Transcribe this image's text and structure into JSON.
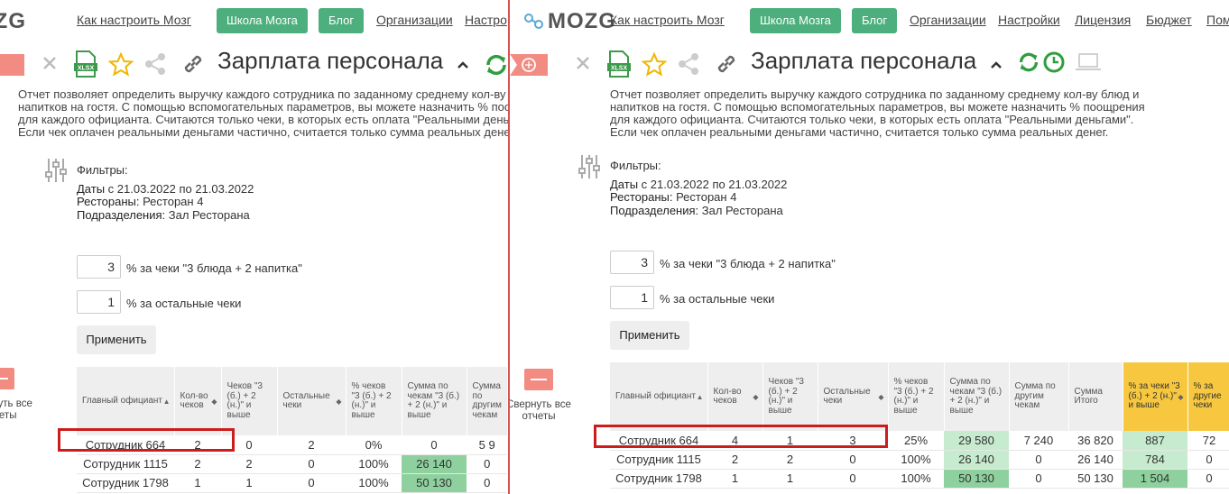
{
  "nav": {
    "logo": "MOZG",
    "links": [
      "Как настроить Мозг",
      "Организации",
      "Настройки",
      "Лицензия",
      "Бюджет",
      "Пом"
    ],
    "buttons": [
      "Школа Мозга",
      "Блог"
    ],
    "left_truncated_link": "Настро"
  },
  "report": {
    "title": "Зарплата персонала",
    "xlsx_label": "XLSX",
    "description": "Отчет позволяет определить выручку каждого сотрудника по заданному среднему кол-ву блюд и напитков на гостя. С помощью вспомогательных параметров, вы можете назначить % поощрения для каждого официанта. Считаются только чеки, в которых есть оплата \"Реальными деньгами\". Если чек оплачен реальными деньгами частично, считается только сумма реальных денег.",
    "filters_header": "Фильтры:",
    "filters": [
      {
        "label": "Даты",
        "value": " с 21.03.2022 по 21.03.2022"
      },
      {
        "label": "Рестораны:",
        "value": " Ресторан 4"
      },
      {
        "label": "Подразделения:",
        "value": " Зал Ресторана"
      }
    ],
    "param1": {
      "value": "3",
      "label": "% за чеки \"3 блюда + 2 напитка\""
    },
    "param2": {
      "value": "1",
      "label": "% за остальные чеки"
    },
    "apply_label": "Применить",
    "collapse_label": "Свернуть все отчеты"
  },
  "table": {
    "headers": [
      "Главный официант",
      "Кол-во чеков",
      "Чеков \"3 (б.) + 2 (н.)\" и выше",
      "Остальные чеки",
      "% чеков \"3 (б.) + 2 (н.)\" и выше",
      "Сумма по чекам \"3 (б.) + 2 (н.)\" и выше",
      "Сумма по другим чекам",
      "Сумма Итого",
      "% за чеки \"3 (б.) + 2 (н.)\" и выше",
      "% за другие чеки"
    ],
    "left_rows": [
      [
        "Сотрудник 664",
        "2",
        "0",
        "2",
        "0%",
        "0",
        "5 9"
      ],
      [
        "Сотрудник 1115",
        "2",
        "2",
        "0",
        "100%",
        "26 140",
        "0"
      ],
      [
        "Сотрудник 1798",
        "1",
        "1",
        "0",
        "100%",
        "50 130",
        "0"
      ]
    ],
    "right_rows": [
      [
        "Сотрудник 664",
        "4",
        "1",
        "3",
        "25%",
        "29 580",
        "7 240",
        "36 820",
        "887",
        "72"
      ],
      [
        "Сотрудник 1115",
        "2",
        "2",
        "0",
        "100%",
        "26 140",
        "0",
        "26 140",
        "784",
        "0"
      ],
      [
        "Сотрудник 1798",
        "1",
        "1",
        "0",
        "100%",
        "50 130",
        "0",
        "50 130",
        "1 504",
        "0"
      ]
    ]
  },
  "colors": {
    "green": "#4caf7d",
    "highlight_green": "#8fd19e",
    "yellow": "#f7c83f",
    "red_box": "#cc1d1d"
  }
}
